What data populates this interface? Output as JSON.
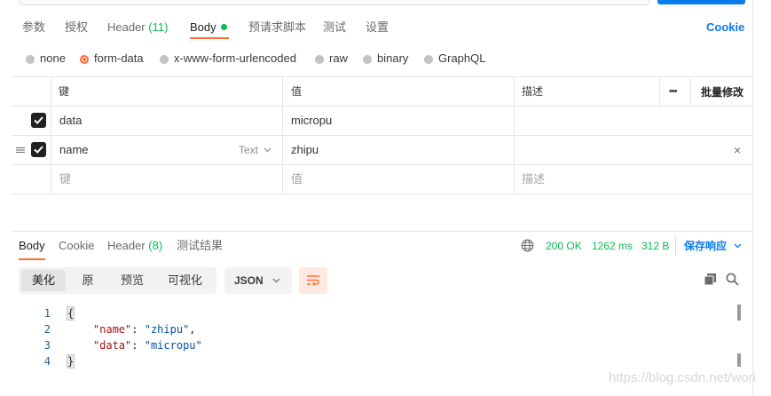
{
  "request_tabs": [
    {
      "label": "参数"
    },
    {
      "label": "授权"
    },
    {
      "label": "Header",
      "count": "(11)"
    },
    {
      "label": "Body"
    },
    {
      "label": "预请求脚本"
    },
    {
      "label": "测试"
    },
    {
      "label": "设置"
    }
  ],
  "cookie_link": "Cookie",
  "body_types": [
    "none",
    "form-data",
    "x-www-form-urlencoded",
    "raw",
    "binary",
    "GraphQL"
  ],
  "body_type_selected": "form-data",
  "table": {
    "headers": {
      "key": "键",
      "value": "值",
      "description": "描述",
      "more": "•••",
      "bulk_edit": "批量修改"
    },
    "rows": [
      {
        "key": "data",
        "value": "micropu",
        "checked": true
      },
      {
        "key": "name",
        "value": "zhipu",
        "checked": true,
        "type": "Text",
        "remove": "×"
      }
    ],
    "placeholder_row": {
      "key": "键",
      "value": "值",
      "description": "描述"
    }
  },
  "response_tabs": [
    {
      "label": "Body"
    },
    {
      "label": "Cookie"
    },
    {
      "label": "Header",
      "count": "(8)"
    },
    {
      "label": "测试结果"
    }
  ],
  "response_status": {
    "status": "200 OK",
    "time": "1262 ms",
    "size": "312 B"
  },
  "save_response": "保存响应",
  "view_modes": [
    "美化",
    "原",
    "预览",
    "可视化"
  ],
  "view_mode_selected": "美化",
  "format": "JSON",
  "code": {
    "line_numbers": [
      "1",
      "2",
      "3",
      "4"
    ],
    "open_brace": "{",
    "close_brace": "}",
    "entries": [
      {
        "key": "\"name\"",
        "value": "\"zhipu\"",
        "trail": ","
      },
      {
        "key": "\"data\"",
        "value": "\"micropu\"",
        "trail": ""
      }
    ],
    "colon": ": "
  },
  "watermark": "https://blog.csdn.net/wori",
  "colors": {
    "accent": "#ff6c37",
    "link": "#097bed",
    "success": "#0cbb52"
  },
  "icons": [
    "globe-icon",
    "chevron-down-icon",
    "wrap-lines-icon",
    "copy-icon",
    "search-icon",
    "drag-handle-icon",
    "check-icon",
    "close-icon"
  ]
}
